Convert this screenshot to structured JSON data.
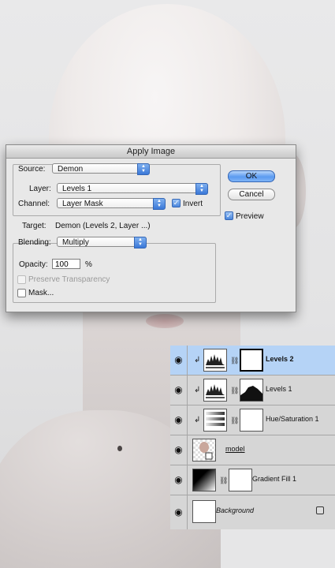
{
  "dialog": {
    "title": "Apply Image",
    "source_label": "Source:",
    "source_value": "Demon",
    "layer_label": "Layer:",
    "layer_value": "Levels 1",
    "channel_label": "Channel:",
    "channel_value": "Layer Mask",
    "invert_label": "Invert",
    "invert_checked": true,
    "target_label": "Target:",
    "target_value": "Demon (Levels 2, Layer ...)",
    "blending_label": "Blending:",
    "blending_value": "Multiply",
    "opacity_label": "Opacity:",
    "opacity_value": "100",
    "opacity_unit": "%",
    "preserve_label": "Preserve Transparency",
    "mask_label": "Mask...",
    "ok_label": "OK",
    "cancel_label": "Cancel",
    "preview_label": "Preview",
    "preview_checked": true
  },
  "layers": [
    {
      "name": "Levels 2",
      "selected": true,
      "clipped": true,
      "thumb": "levels-icon",
      "mask": "white",
      "style": "bold"
    },
    {
      "name": "Levels 1",
      "selected": false,
      "clipped": true,
      "thumb": "levels-icon",
      "mask": "silhouette",
      "style": "normal"
    },
    {
      "name": "Hue/Saturation 1",
      "selected": false,
      "clipped": true,
      "thumb": "hue-saturation-icon",
      "mask": "white",
      "style": "normal"
    },
    {
      "name": "model",
      "selected": false,
      "clipped": false,
      "thumb": "smart-object",
      "mask": "none",
      "style": "underline"
    },
    {
      "name": "Gradient Fill 1",
      "selected": false,
      "clipped": false,
      "thumb": "gradient-icon",
      "mask": "white",
      "style": "normal"
    },
    {
      "name": "Background",
      "selected": false,
      "clipped": false,
      "thumb": "white",
      "mask": "none",
      "style": "italic",
      "locked": true
    }
  ],
  "colors": {
    "accent": "#3a78d8",
    "selected_layer": "#b5d3f6"
  }
}
